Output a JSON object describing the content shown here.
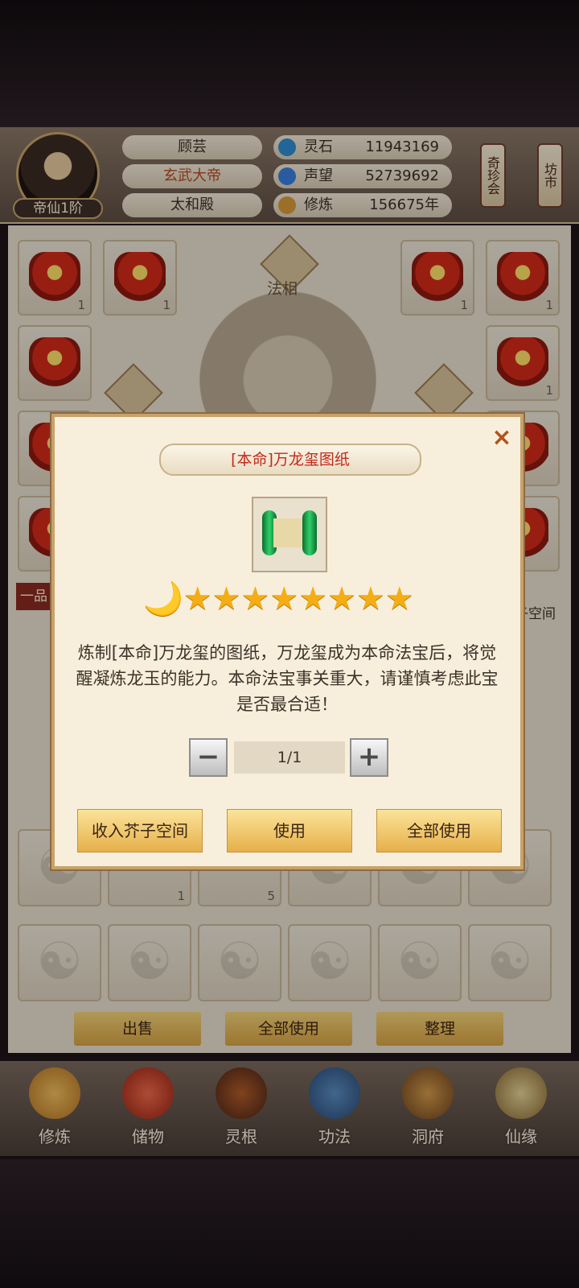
{
  "player": {
    "name": "顾芸",
    "title": "玄武大帝",
    "location": "太和殿",
    "rank": "帝仙1阶"
  },
  "stats": [
    {
      "label": "灵石",
      "value": "11943169"
    },
    {
      "label": "声望",
      "value": "52739692"
    },
    {
      "label": "修炼",
      "value": "156675年"
    }
  ],
  "side_buttons": {
    "qizhenhui": "奇珍会",
    "fangshi": "坊市"
  },
  "panel": {
    "faxiang_label": "法相",
    "left_tab": "一品",
    "space_label": "子空间",
    "qty_one": "1",
    "qty_five": "5"
  },
  "actions": {
    "sell": "出售",
    "use_all": "全部使用",
    "sort": "整理"
  },
  "nav": [
    {
      "label": "修炼",
      "icon": "cultivate-icon"
    },
    {
      "label": "储物",
      "icon": "storage-bag-icon"
    },
    {
      "label": "灵根",
      "icon": "spirit-root-icon"
    },
    {
      "label": "功法",
      "icon": "technique-book-icon"
    },
    {
      "label": "洞府",
      "icon": "cave-house-icon"
    },
    {
      "label": "仙缘",
      "icon": "fate-gourd-icon"
    }
  ],
  "dialog": {
    "title": "[本命]万龙玺图纸",
    "close": "×",
    "stars": "🌙★★★★★★★★",
    "description": "炼制[本命]万龙玺的图纸，万龙玺成为本命法宝后，将觉醒凝炼龙玉的能力。本命法宝事关重大，请谨慎考虑此宝是否最合适！",
    "quantity": "1/1",
    "minus": "−",
    "plus": "+",
    "btn_store": "收入芥子空间",
    "btn_use": "使用",
    "btn_use_all": "全部使用"
  },
  "colors": {
    "accent_red": "#c22a1b",
    "button_gold": "#e6b04a",
    "close_orange": "#b1531e"
  }
}
